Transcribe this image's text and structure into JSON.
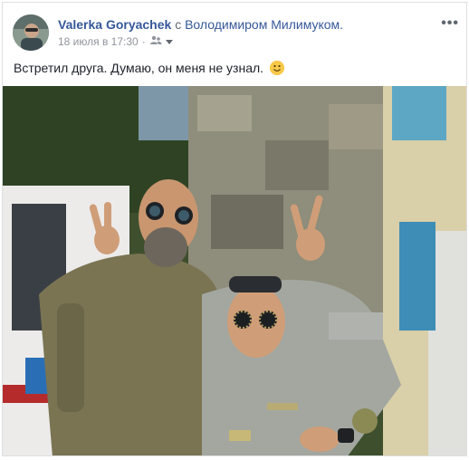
{
  "post": {
    "author": "Valerka Goryachek",
    "connector": "с",
    "with": "Володимиром Милимуком.",
    "timestamp": "18 июля в 17:30",
    "separator": "·",
    "text": "Встретил друга. Думаю, он меня не узнал.",
    "more_label": "•••",
    "icons": [
      "friends-audience-icon",
      "chevron-down-icon",
      "smile-emoji-icon",
      "more-options-icon"
    ]
  },
  "colors": {
    "link": "#365899",
    "text": "#1d2129",
    "muted": "#90949c",
    "border": "#dddfe2"
  }
}
